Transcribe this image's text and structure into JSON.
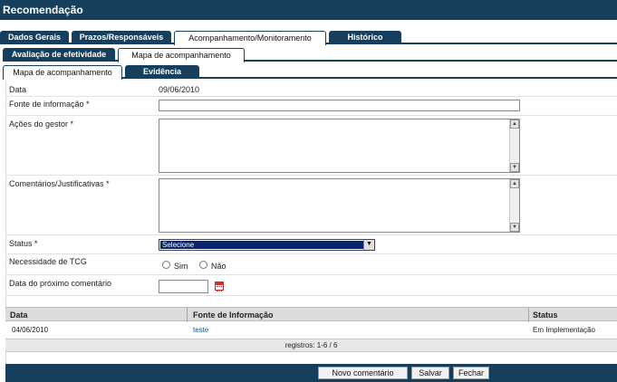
{
  "window": {
    "title": "Recomendação"
  },
  "tabs_main": [
    {
      "label": "Dados Gerais"
    },
    {
      "label": "Prazos/Responsáveis"
    },
    {
      "label": "Acompanhamento/Monitoramento"
    },
    {
      "label": "Histórico"
    }
  ],
  "tabs_sub": [
    {
      "label": "Avaliação de efetividade"
    },
    {
      "label": "Mapa de acompanhamento"
    }
  ],
  "tabs_inner": [
    {
      "label": "Mapa de acompanhamento"
    },
    {
      "label": "Evidência"
    }
  ],
  "form": {
    "data_label": "Data",
    "data_value": "09/06/2010",
    "fonte_label": "Fonte de informação *",
    "fonte_value": "",
    "acoes_label": "Ações do gestor *",
    "acoes_value": "",
    "comentarios_label": "Comentários/Justificativas *",
    "comentarios_value": "",
    "status_label": "Status *",
    "status_value": "Selecione",
    "tcg_label": "Necessidade de TCG",
    "tcg_sim": "Sim",
    "tcg_nao": "Não",
    "proximo_label": "Data do próximo comentário",
    "proximo_value": ""
  },
  "table": {
    "headers": [
      "Data",
      "Fonte de Informação",
      "Status"
    ],
    "rows": [
      {
        "data": "04/06/2010",
        "fonte": "teste",
        "status": "Em Implementação"
      }
    ],
    "footer": "registros: 1-6 / 6"
  },
  "actions": {
    "novo": "Novo comentário",
    "salvar": "Salvar",
    "fechar": "Fechar"
  },
  "colors": {
    "brand": "#163f5e",
    "link": "#1b4f8a",
    "select_highlight": "#0a246a"
  }
}
